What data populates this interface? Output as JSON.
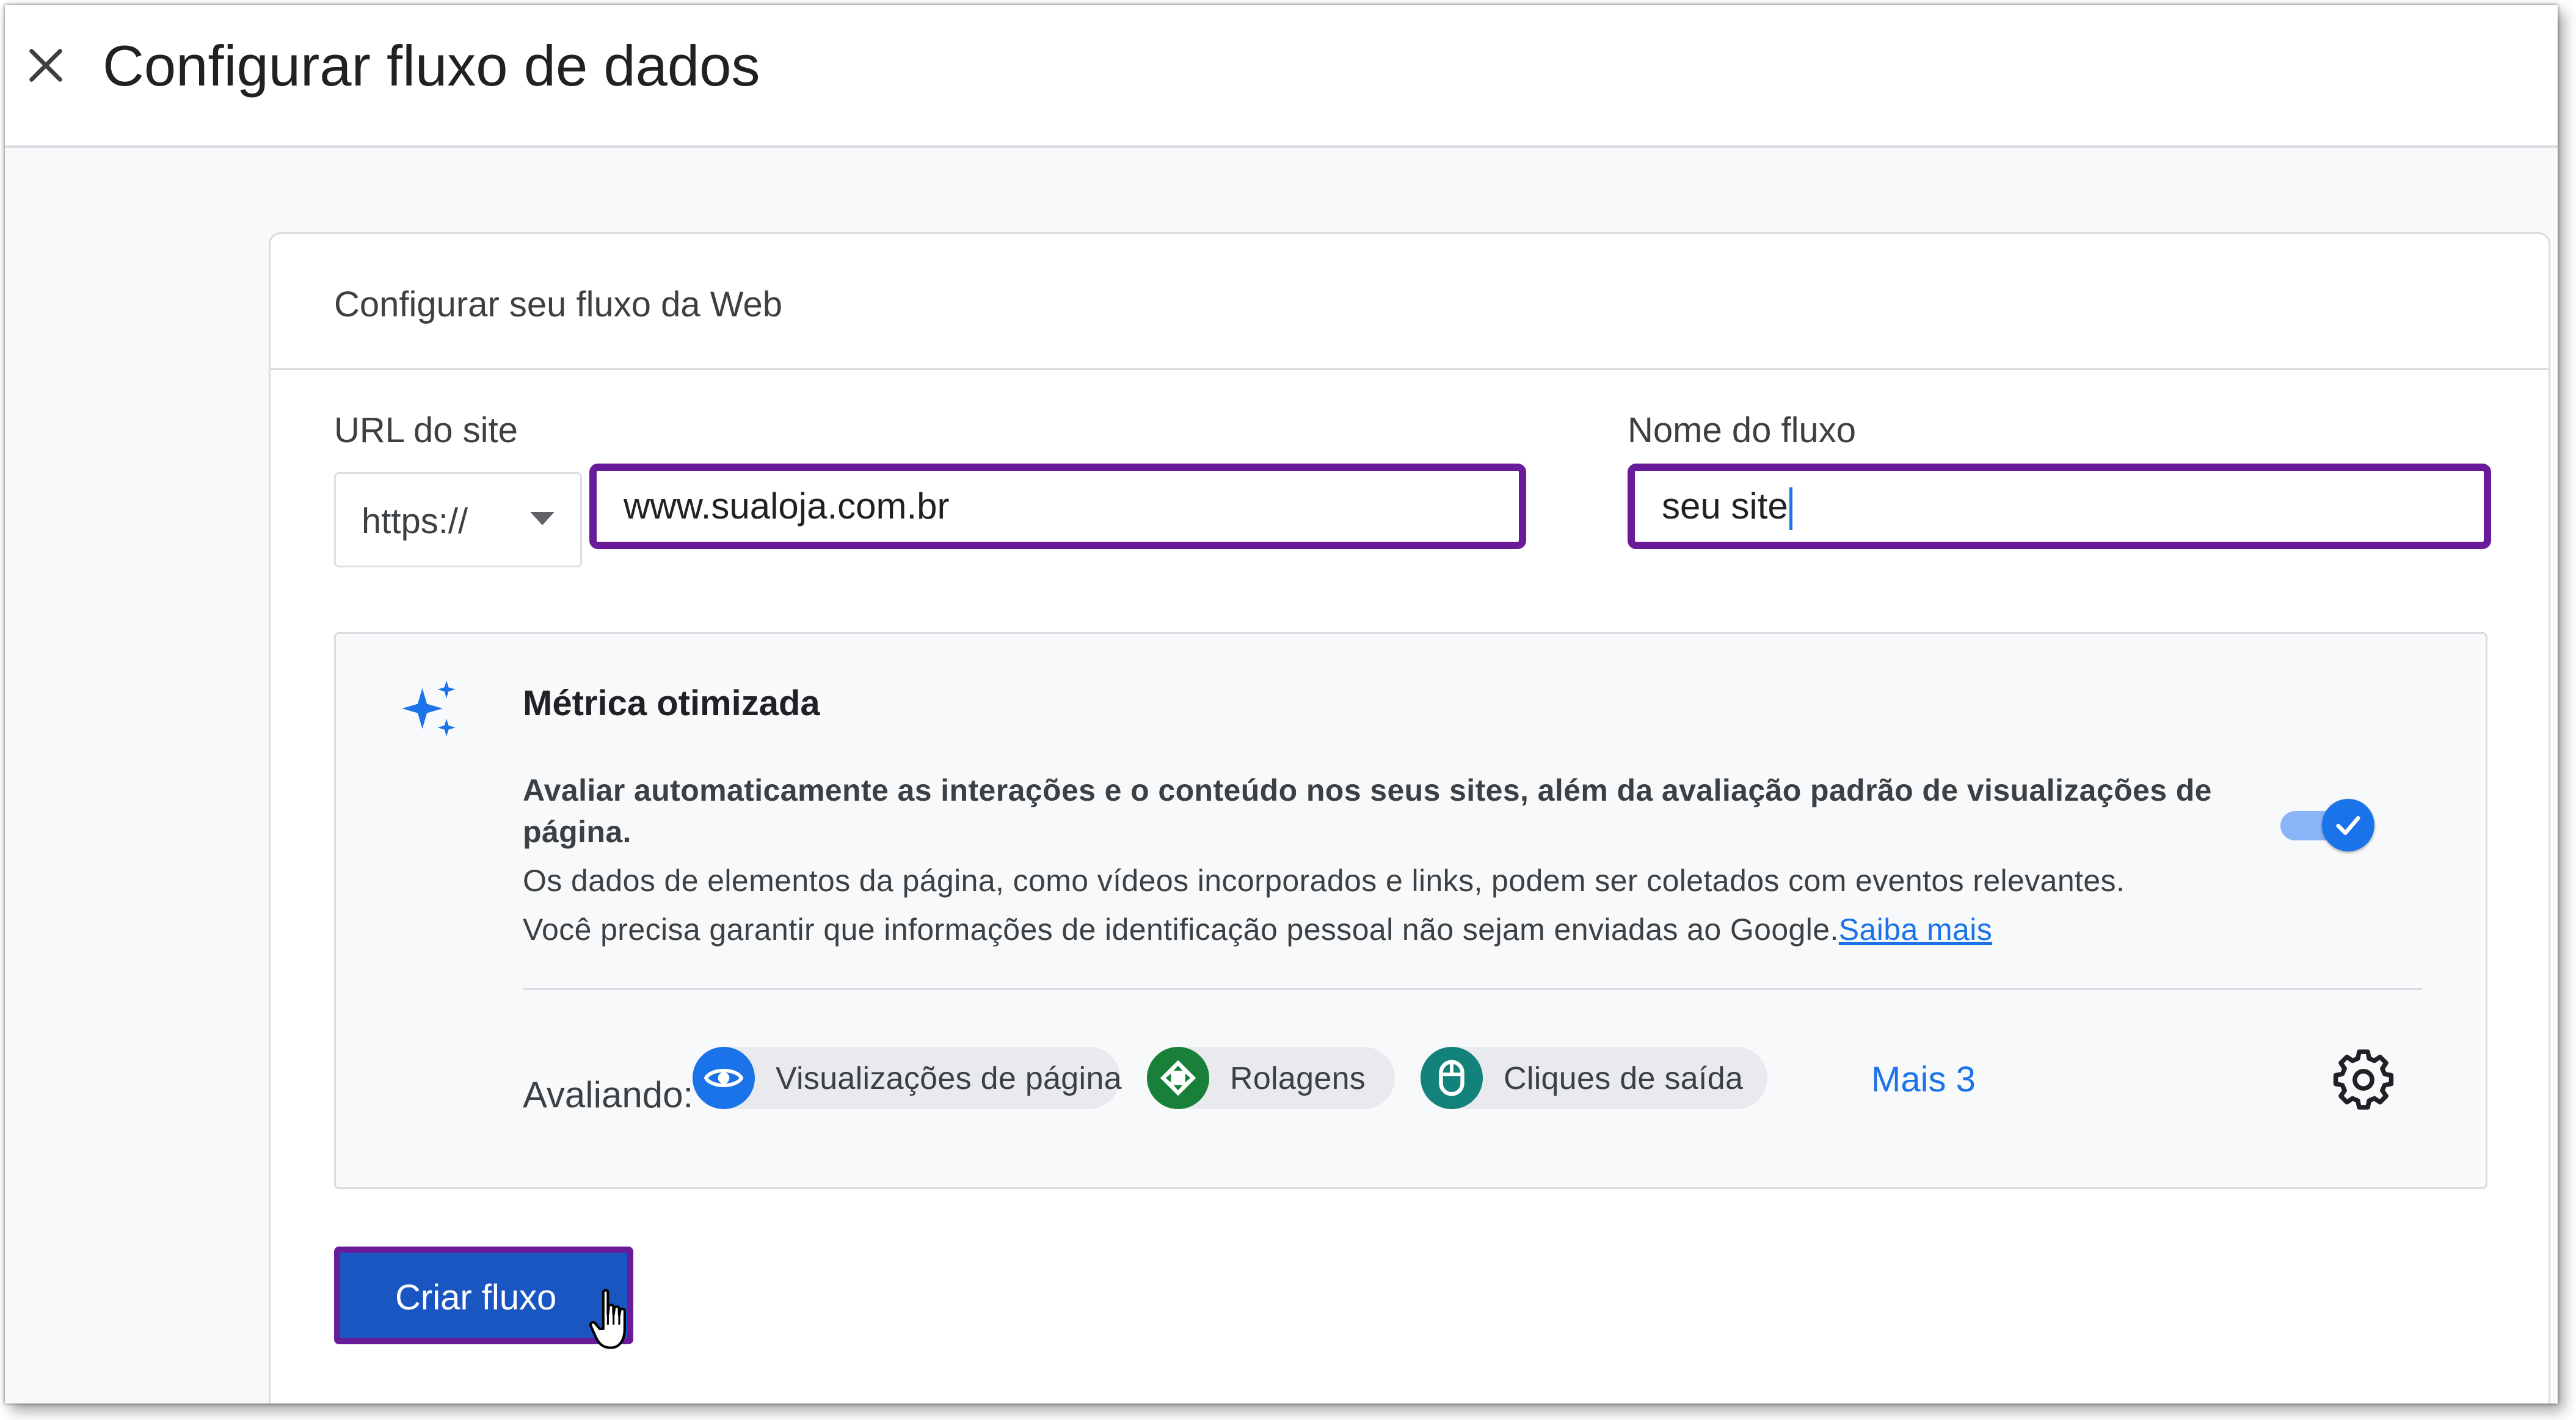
{
  "header": {
    "title": "Configurar fluxo de dados"
  },
  "card": {
    "title": "Configurar seu fluxo da Web"
  },
  "form": {
    "url_label": "URL do site",
    "scheme_value": "https://",
    "url_value": "www.sualoja.com.br",
    "name_label": "Nome do fluxo",
    "name_value": "seu site"
  },
  "enhanced": {
    "title": "Métrica otimizada",
    "description": "Avaliar automaticamente as interações e o conteúdo nos seus sites, além da avaliação padrão de visualizações de página.",
    "note1": "Os dados de elementos da página, como vídeos incorporados e links, podem ser coletados com eventos relevantes.",
    "note2": "Você precisa garantir que informações de identificação pessoal não sejam enviadas ao Google.",
    "learn_more": "Saiba mais",
    "toggle_on": true,
    "measuring_label": "Avaliando:",
    "chips": [
      {
        "label": "Visualizações de página",
        "icon": "eye-icon",
        "color": "#1a73e8"
      },
      {
        "label": "Rolagens",
        "icon": "scroll-arrows-icon",
        "color": "#188038"
      },
      {
        "label": "Cliques de saída",
        "icon": "mouse-icon",
        "color": "#12827a"
      }
    ],
    "more": "Mais 3"
  },
  "actions": {
    "create_label": "Criar fluxo"
  },
  "colors": {
    "accent": "#1a73e8",
    "highlight_border": "#6a1b9a",
    "button": "#1a56c2"
  }
}
